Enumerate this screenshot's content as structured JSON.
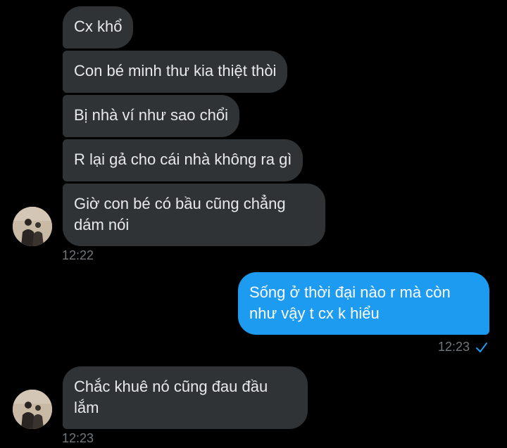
{
  "thread": {
    "group1": {
      "messages": [
        "Cx khổ",
        "Con bé minh thư kia thiệt thòi",
        "Bị nhà ví như sao chổi",
        "R lại gả cho cái nhà không ra gì",
        "Giờ con bé có bầu cũng chẳng dám nói"
      ],
      "timestamp": "12:22"
    },
    "group2": {
      "message": "Sống ở thời đại nào r mà còn như vậy t cx k hiểu",
      "timestamp": "12:23",
      "status_icon": "check-icon"
    },
    "group3": {
      "message": "Chắc khuê nó cũng đau đầu lắm",
      "timestamp": "12:23"
    }
  },
  "colors": {
    "background": "#000000",
    "incoming_bubble": "#2f3336",
    "outgoing_bubble": "#1d9bf0",
    "timestamp_text": "#71767b",
    "check_icon": "#1d9bf0"
  }
}
